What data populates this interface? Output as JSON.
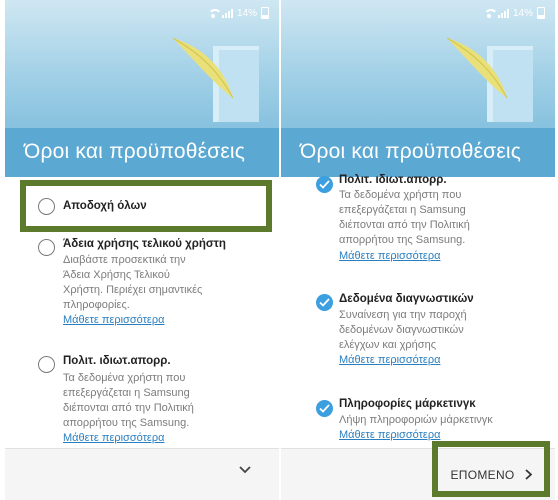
{
  "status": {
    "battery": "14%"
  },
  "left": {
    "title": "Όροι και προϋποθέσεις",
    "accept_all": "Αποδοχή όλων",
    "items": [
      {
        "title": "Άδεια χρήσης τελικού χρήστη",
        "desc": [
          "Διαβάστε προσεκτικά την",
          "Άδεια Χρήσης Τελικού",
          "Χρήστη. Περιέχει σημαντικές",
          "πληροφορίες."
        ],
        "link": "Μάθετε περισσότερα"
      },
      {
        "title": "Πολιτ. ιδιωτ.απορρ.",
        "desc": [
          "Τα δεδομένα χρήστη που",
          "επεξεργάζεται η Samsung",
          "διέπονται από την Πολιτική",
          "απορρήτου της Samsung."
        ],
        "link": "Μάθετε περισσότερα"
      }
    ]
  },
  "right": {
    "title": "Όροι και προϋποθέσεις",
    "items": [
      {
        "title": "Πολιτ. ιδιωτ.απορρ.",
        "desc": [
          "Τα δεδομένα χρήστη που",
          "επεξεργάζεται η Samsung",
          "διέπονται από την Πολιτική",
          "απορρήτου της Samsung."
        ],
        "link": "Μάθετε περισσότερα"
      },
      {
        "title": "Δεδομένα διαγνωστικών",
        "desc": [
          "Συναίνεση για την παροχή",
          "δεδομένων διαγνωστικών",
          "ελέγχων και χρήσης"
        ],
        "link": "Μάθετε περισσότερα"
      },
      {
        "title": "Πληροφορίες μάρκετινγκ",
        "desc": [
          "Λήψη πληροφοριών μάρκετινγκ"
        ],
        "link": "Μάθετε περισσότερα"
      }
    ],
    "next_label": "ΕΠΟΜΕΝΟ"
  },
  "colors": {
    "header_top": "#cfe7f2",
    "title_band": "#5ba9d3",
    "check": "#3c9fe0",
    "link": "#2a7fc0",
    "highlight": "#5b7a2c"
  }
}
